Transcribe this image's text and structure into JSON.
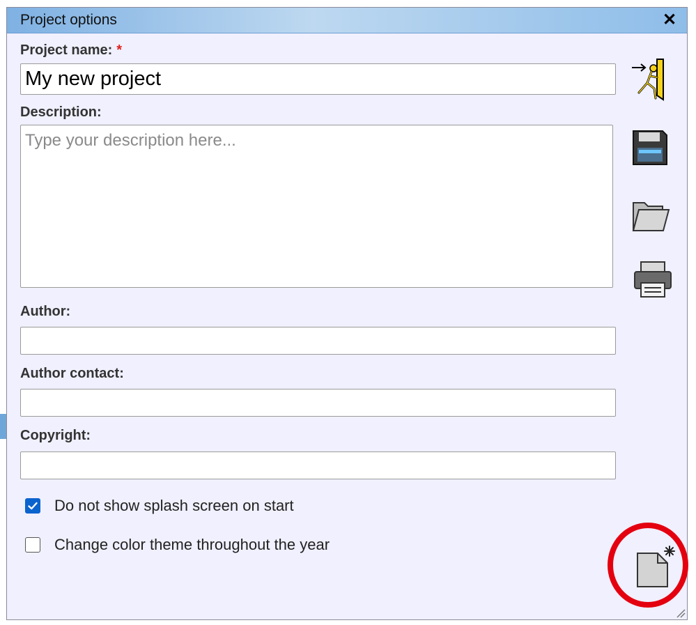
{
  "dialog": {
    "title": "Project options",
    "close_glyph": "✕"
  },
  "fields": {
    "project_name_label": "Project name:",
    "required_marker": "*",
    "project_name_value": "My new project",
    "description_label": "Description:",
    "description_placeholder": "Type your description here...",
    "author_label": "Author:",
    "author_value": "",
    "author_contact_label": "Author contact:",
    "author_contact_value": "",
    "copyright_label": "Copyright:",
    "copyright_value": ""
  },
  "options": [
    {
      "label": "Do not show splash screen on start",
      "checked": true
    },
    {
      "label": "Change color theme throughout the year",
      "checked": false
    }
  ],
  "toolbar_icons": [
    "exit-icon",
    "save-icon",
    "open-folder-icon",
    "print-icon",
    "new-document-icon"
  ],
  "colors": {
    "titlebar_accent": "#7fb1e3",
    "dialog_bg": "#f0f0ff",
    "required": "#e0201c",
    "checkbox_checked": "#0b63ce",
    "highlight_ring": "#e4000f"
  }
}
